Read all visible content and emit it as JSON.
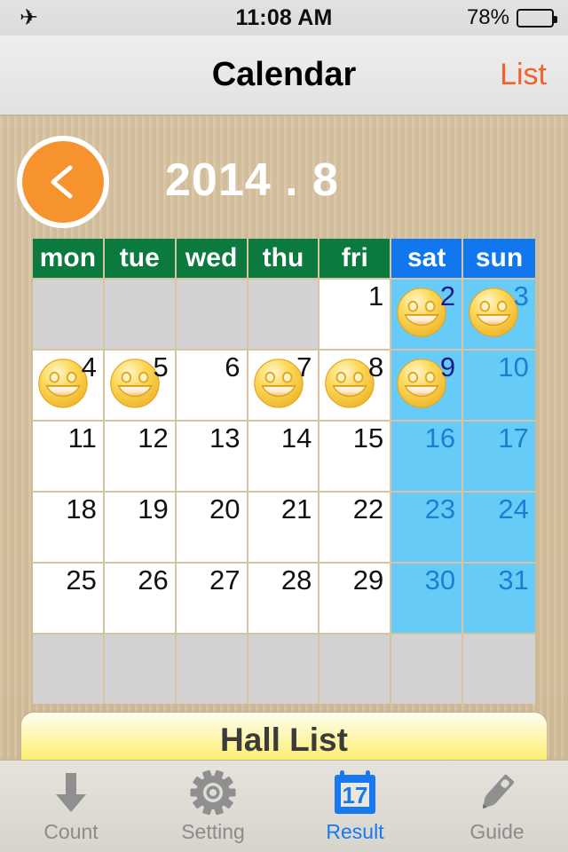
{
  "status_bar": {
    "airplane_icon": "airplane-mode-icon",
    "time": "11:08 AM",
    "battery_percent": "78%",
    "battery_level": 78
  },
  "nav_bar": {
    "title": "Calendar",
    "right_button": "List",
    "right_button_color": "#f1622a"
  },
  "month_header": {
    "back_button_icon": "chevron-left-icon",
    "back_button_color": "#f7932e",
    "year_month": "2014 . 8"
  },
  "calendar": {
    "weekday_headers": [
      {
        "label": "mon",
        "type": "weekday"
      },
      {
        "label": "tue",
        "type": "weekday"
      },
      {
        "label": "wed",
        "type": "weekday"
      },
      {
        "label": "thu",
        "type": "weekday"
      },
      {
        "label": "fri",
        "type": "weekday"
      },
      {
        "label": "sat",
        "type": "weekend"
      },
      {
        "label": "sun",
        "type": "weekend"
      }
    ],
    "weekday_header_color": "#0b7a3e",
    "weekend_header_color": "#1177ee",
    "weekend_cell_color": "#66ccf7",
    "blank_cell_color": "#d2d2d2",
    "gridline_color": "#d9c4a2",
    "marked_icon": "smiley-face-icon",
    "weeks": [
      [
        {
          "day": "",
          "kind": "blank"
        },
        {
          "day": "",
          "kind": "blank"
        },
        {
          "day": "",
          "kind": "blank"
        },
        {
          "day": "",
          "kind": "blank"
        },
        {
          "day": "1",
          "kind": "weekday",
          "marked": false
        },
        {
          "day": "2",
          "kind": "sat",
          "marked": true
        },
        {
          "day": "3",
          "kind": "sun",
          "marked": true
        }
      ],
      [
        {
          "day": "4",
          "kind": "weekday",
          "marked": true
        },
        {
          "day": "5",
          "kind": "weekday",
          "marked": true
        },
        {
          "day": "6",
          "kind": "weekday",
          "marked": false
        },
        {
          "day": "7",
          "kind": "weekday",
          "marked": true
        },
        {
          "day": "8",
          "kind": "weekday",
          "marked": true
        },
        {
          "day": "9",
          "kind": "sat",
          "marked": true
        },
        {
          "day": "10",
          "kind": "sun",
          "marked": false
        }
      ],
      [
        {
          "day": "11",
          "kind": "weekday",
          "marked": false
        },
        {
          "day": "12",
          "kind": "weekday",
          "marked": false
        },
        {
          "day": "13",
          "kind": "weekday",
          "marked": false
        },
        {
          "day": "14",
          "kind": "weekday",
          "marked": false
        },
        {
          "day": "15",
          "kind": "weekday",
          "marked": false
        },
        {
          "day": "16",
          "kind": "sat",
          "marked": false
        },
        {
          "day": "17",
          "kind": "sun",
          "marked": false
        }
      ],
      [
        {
          "day": "18",
          "kind": "weekday",
          "marked": false
        },
        {
          "day": "19",
          "kind": "weekday",
          "marked": false
        },
        {
          "day": "20",
          "kind": "weekday",
          "marked": false
        },
        {
          "day": "21",
          "kind": "weekday",
          "marked": false
        },
        {
          "day": "22",
          "kind": "weekday",
          "marked": false
        },
        {
          "day": "23",
          "kind": "sat",
          "marked": false
        },
        {
          "day": "24",
          "kind": "sun",
          "marked": false
        }
      ],
      [
        {
          "day": "25",
          "kind": "weekday",
          "marked": false
        },
        {
          "day": "26",
          "kind": "weekday",
          "marked": false
        },
        {
          "day": "27",
          "kind": "weekday",
          "marked": false
        },
        {
          "day": "28",
          "kind": "weekday",
          "marked": false
        },
        {
          "day": "29",
          "kind": "weekday",
          "marked": false
        },
        {
          "day": "30",
          "kind": "sat",
          "marked": false
        },
        {
          "day": "31",
          "kind": "sun",
          "marked": false
        }
      ],
      [
        {
          "day": "",
          "kind": "blank"
        },
        {
          "day": "",
          "kind": "blank"
        },
        {
          "day": "",
          "kind": "blank"
        },
        {
          "day": "",
          "kind": "blank"
        },
        {
          "day": "",
          "kind": "blank"
        },
        {
          "day": "",
          "kind": "blank"
        },
        {
          "day": "",
          "kind": "blank"
        }
      ]
    ]
  },
  "hall_list_button": {
    "label": "Hall List"
  },
  "tab_bar": {
    "items": [
      {
        "label": "Count",
        "icon": "down-arrow-icon",
        "active": false
      },
      {
        "label": "Setting",
        "icon": "gear-icon",
        "active": false
      },
      {
        "label": "Result",
        "icon": "calendar-17-icon",
        "active": true
      },
      {
        "label": "Guide",
        "icon": "pencil-icon",
        "active": false
      }
    ],
    "active_color": "#1878f0",
    "inactive_color": "#8b8b8b"
  }
}
